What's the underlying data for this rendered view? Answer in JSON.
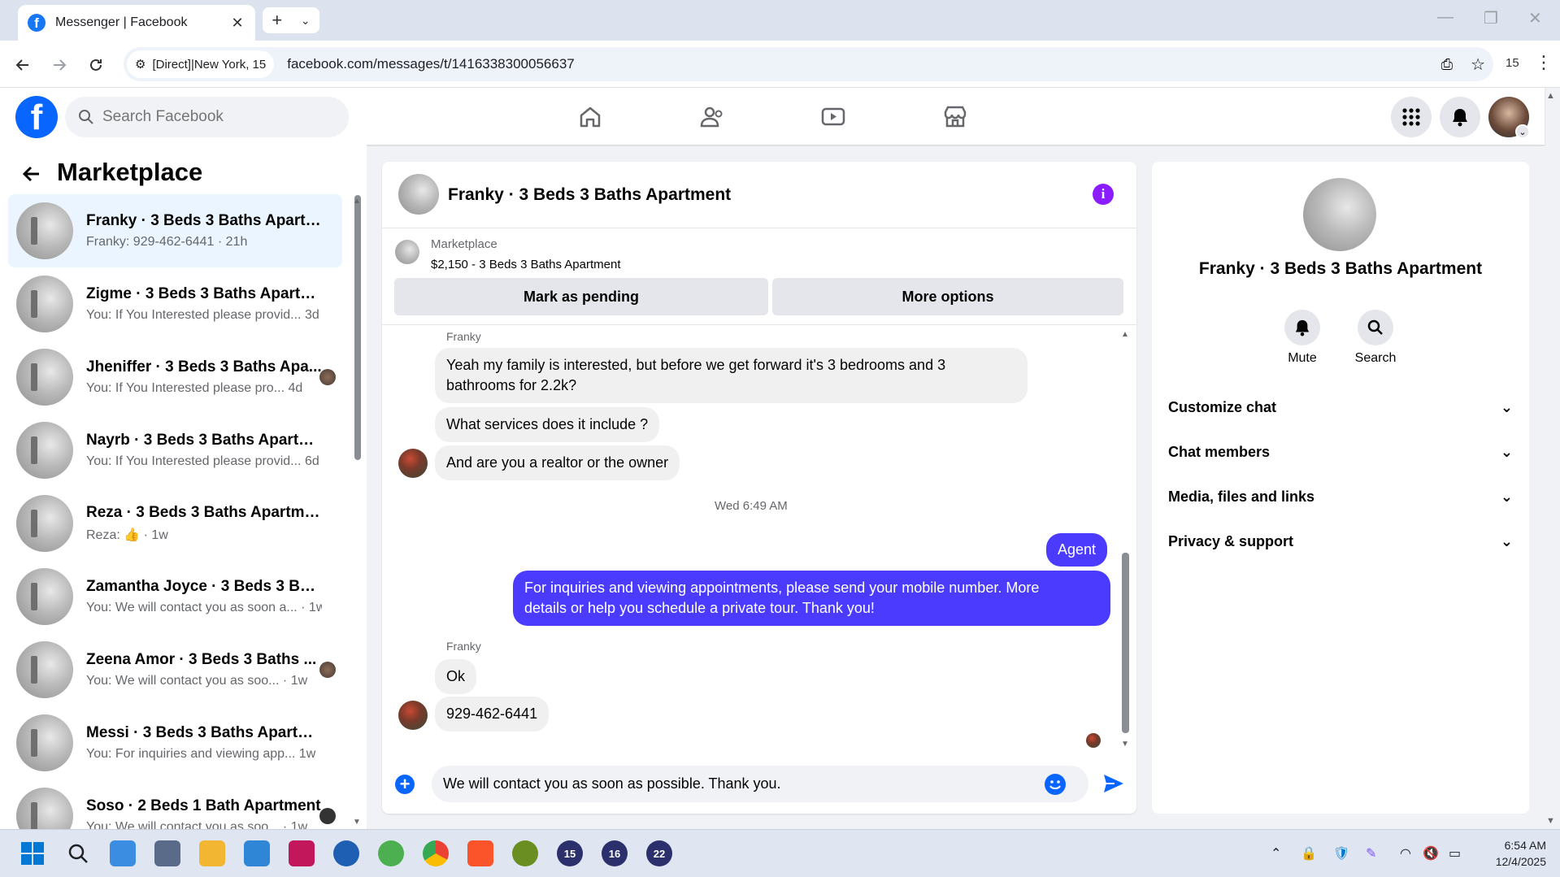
{
  "browser": {
    "tab_title": "Messenger | Facebook",
    "site_chip": "[Direct]|New York, 15",
    "url": "facebook.com/messages/t/1416338300056637",
    "profile_badge": "15"
  },
  "fb": {
    "search_placeholder": "Search Facebook"
  },
  "sidebar": {
    "title": "Marketplace",
    "conversations": [
      {
        "name": "Franky · 3 Beds 3 Baths Apartme...",
        "preview": "Franky: 929-462-6441 · 21h"
      },
      {
        "name": "Zigme · 3 Beds 3 Baths Apartment",
        "preview": "You: If You Interested please provid...",
        "time": "3d"
      },
      {
        "name": "Jheniffer · 3 Beds 3 Baths Apa...",
        "preview": "You: If You Interested please pro...",
        "time": "4d"
      },
      {
        "name": "Nayrb · 3 Beds 3 Baths Apartment",
        "preview": "You: If You Interested please provid...",
        "time": "6d"
      },
      {
        "name": "Reza · 3 Beds 3 Baths Apartment",
        "preview": "Reza:",
        "time": "· 1w"
      },
      {
        "name": "Zamantha Joyce · 3 Beds 3 Bath...",
        "preview": "You: We will contact you as soon a...",
        "time": "· 1w"
      },
      {
        "name": "Zeena Amor · 3 Beds 3 Baths ...",
        "preview": "You: We will contact you as soo...",
        "time": "· 1w"
      },
      {
        "name": "Messi · 3 Beds 3 Baths Apartment",
        "preview": "You: For inquiries and viewing app...",
        "time": "1w"
      },
      {
        "name": "Soso · 2 Beds 1 Bath Apartment",
        "preview": "You: We will contact you as soo...",
        "time": "· 1w"
      }
    ]
  },
  "chat": {
    "title": "Franky · 3 Beds 3 Baths Apartment",
    "listing_source": "Marketplace",
    "listing_summary": "$2,150 - 3 Beds 3 Baths Apartment",
    "mark_pending_label": "Mark as pending",
    "more_options_label": "More options",
    "sender_name": "Franky",
    "msg1_line1": "Yeah my family is interested, but before we get forward it's 3 bedrooms and 3",
    "msg1_line2": "bathrooms for 2.2k?",
    "msg2": "What services does it include ?",
    "msg3": "And are you a realtor or the owner",
    "timestamp": "Wed 6:49 AM",
    "agent_label": "Agent",
    "my_msg_line1": "For inquiries and viewing appointments, please send your mobile number. More",
    "my_msg_line2": "details or help you schedule a private tour. Thank you!",
    "sender_name2": "Franky",
    "msg4": "Ok",
    "msg5": "929-462-6441",
    "composer_value": "We will contact you as soon as possible. Thank you."
  },
  "info": {
    "title": "Franky · 3 Beds 3 Baths Apartment",
    "mute_label": "Mute",
    "search_label": "Search",
    "sections": [
      "Customize chat",
      "Chat members",
      "Media, files and links",
      "Privacy & support"
    ]
  },
  "taskbar": {
    "badges": [
      "15",
      "16",
      "22"
    ],
    "time": "6:54 AM",
    "date": "12/4/2025"
  },
  "colors": {
    "fb_blue": "#0866ff",
    "my_bubble": "#4a3bff",
    "info_icon": "#8a1cff"
  }
}
